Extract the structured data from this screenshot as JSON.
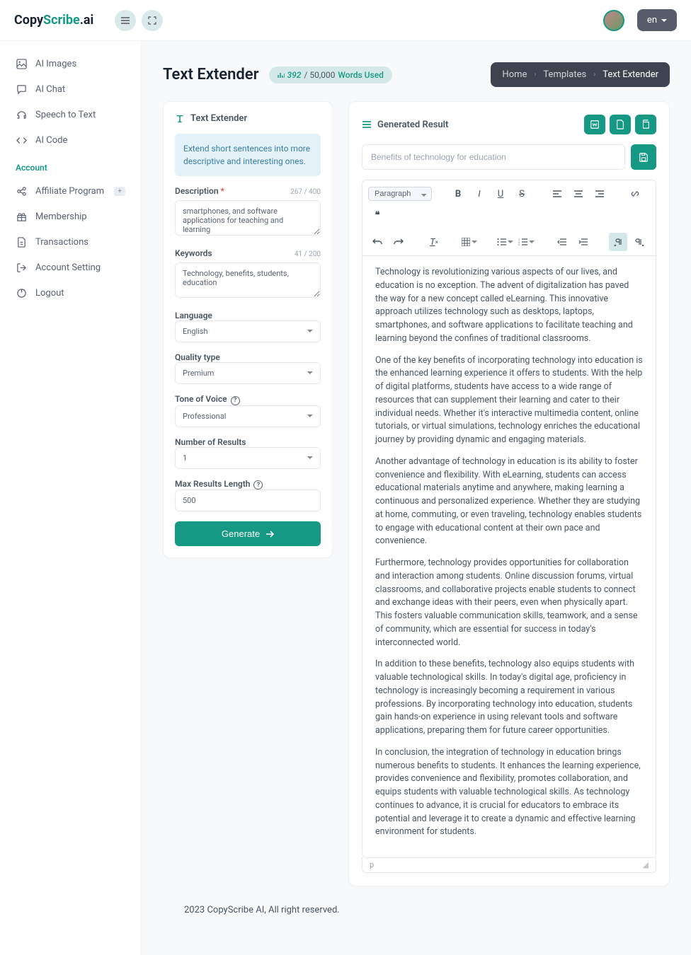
{
  "brand": {
    "part1": "Copy",
    "part2": "Scribe",
    "part3": ".ai"
  },
  "topbar": {
    "lang": "en"
  },
  "sidebar": {
    "items": [
      {
        "label": "AI Images"
      },
      {
        "label": "AI Chat"
      },
      {
        "label": "Speech to Text"
      },
      {
        "label": "AI Code"
      }
    ],
    "account_label": "Account",
    "account_items": [
      {
        "label": "Affiliate Program",
        "badge": "+"
      },
      {
        "label": "Membership"
      },
      {
        "label": "Transactions"
      },
      {
        "label": "Account Setting"
      },
      {
        "label": "Logout"
      }
    ]
  },
  "page": {
    "title": "Text Extender",
    "words_used": "392",
    "words_limit": "/ 50,000",
    "words_label": "Words Used",
    "breadcrumb": {
      "home": "Home",
      "templates": "Templates",
      "current": "Text Extender"
    }
  },
  "form": {
    "panel_title": "Text Extender",
    "info": "Extend short sentences into more descriptive and interesting ones.",
    "description": {
      "label": "Description",
      "counter": "267 / 400",
      "value": "smartphones, and software applications for teaching and learning"
    },
    "keywords": {
      "label": "Keywords",
      "counter": "41 / 200",
      "value": "Technology, benefits, students, education"
    },
    "language": {
      "label": "Language",
      "value": "English"
    },
    "quality": {
      "label": "Quality type",
      "value": "Premium"
    },
    "tone": {
      "label": "Tone of Voice",
      "value": "Professional"
    },
    "results": {
      "label": "Number of Results",
      "value": "1"
    },
    "maxlen": {
      "label": "Max Results Length",
      "value": "500"
    },
    "generate": "Generate"
  },
  "result": {
    "panel_title": "Generated Result",
    "title_placeholder": "Benefits of technology for education",
    "paragraph_label": "Paragraph",
    "status_tag": "p",
    "paragraphs": [
      "Technology is revolutionizing various aspects of our lives, and education is no exception. The advent of digitalization has paved the way for a new concept called eLearning. This innovative approach utilizes technology such as desktops, laptops, smartphones, and software applications to facilitate teaching and learning beyond the confines of traditional classrooms.",
      "One of the key benefits of incorporating technology into education is the enhanced learning experience it offers to students. With the help of digital platforms, students have access to a wide range of resources that can supplement their learning and cater to their individual needs. Whether it's interactive multimedia content, online tutorials, or virtual simulations, technology enriches the educational journey by providing dynamic and engaging materials.",
      "Another advantage of technology in education is its ability to foster convenience and flexibility. With eLearning, students can access educational materials anytime and anywhere, making learning a continuous and personalized experience. Whether they are studying at home, commuting, or even traveling, technology enables students to engage with educational content at their own pace and convenience.",
      "Furthermore, technology provides opportunities for collaboration and interaction among students. Online discussion forums, virtual classrooms, and collaborative projects enable students to connect and exchange ideas with their peers, even when physically apart. This fosters valuable communication skills, teamwork, and a sense of community, which are essential for success in today's interconnected world.",
      "In addition to these benefits, technology also equips students with valuable technological skills. In today's digital age, proficiency in technology is increasingly becoming a requirement in various professions. By incorporating technology into education, students gain hands-on experience in using relevant tools and software applications, preparing them for future career opportunities.",
      "In conclusion, the integration of technology in education brings numerous benefits to students. It enhances the learning experience, provides convenience and flexibility, promotes collaboration, and equips students with valuable technological skills. As technology continues to advance, it is crucial for educators to embrace its potential and leverage it to create a dynamic and effective learning environment for students."
    ]
  },
  "footer": "2023 CopyScribe AI, All right reserved."
}
